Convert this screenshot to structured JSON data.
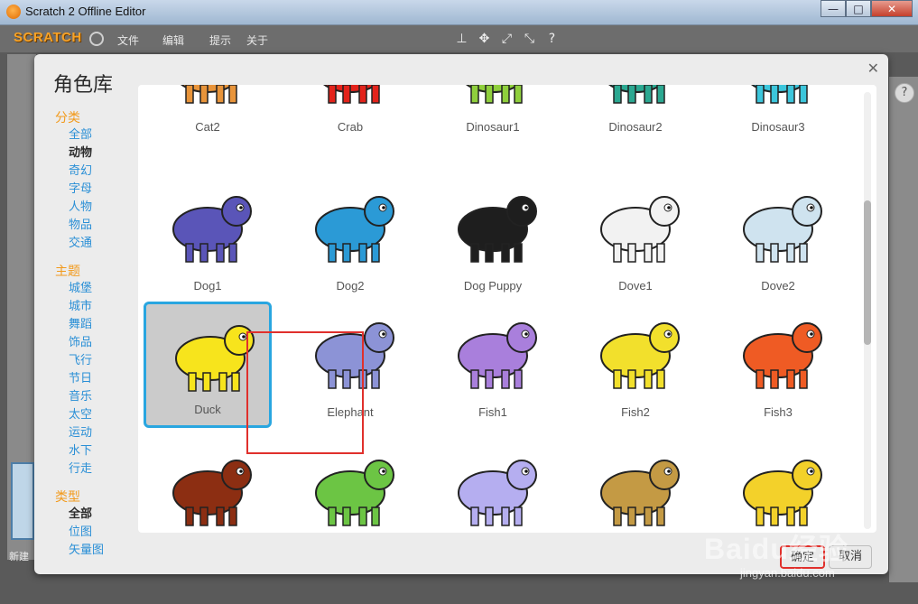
{
  "window": {
    "title": "Scratch 2 Offline Editor",
    "controls": [
      "—",
      "□",
      "✕"
    ]
  },
  "menubar": {
    "logo": "SCRATCH",
    "items": [
      "文件",
      "编辑",
      "提示",
      "关于"
    ]
  },
  "dialog": {
    "title": "角色库",
    "sidebar": {
      "category_head": "分类",
      "categories": [
        "全部",
        "动物",
        "奇幻",
        "字母",
        "人物",
        "物品",
        "交通"
      ],
      "active_category": "动物",
      "theme_head": "主题",
      "themes": [
        "城堡",
        "城市",
        "舞蹈",
        "饰品",
        "飞行",
        "节日",
        "音乐",
        "太空",
        "运动",
        "水下",
        "行走"
      ],
      "type_head": "类型",
      "types": [
        "全部",
        "位图",
        "矢量图"
      ],
      "active_type": "全部"
    },
    "sprites": [
      {
        "name": "Cat2",
        "icon": "cat-icon",
        "color": "#e8943a"
      },
      {
        "name": "Crab",
        "icon": "crab-icon",
        "color": "#e3231b"
      },
      {
        "name": "Dinosaur1",
        "icon": "dinosaur-icon",
        "color": "#8fcf3c"
      },
      {
        "name": "Dinosaur2",
        "icon": "dinosaur-icon",
        "color": "#2ba891"
      },
      {
        "name": "Dinosaur3",
        "icon": "dinosaur-icon",
        "color": "#3cc6dc"
      },
      {
        "name": "Dog1",
        "icon": "dog-icon",
        "color": "#5a55b8"
      },
      {
        "name": "Dog2",
        "icon": "dog-icon",
        "color": "#2b9ad6"
      },
      {
        "name": "Dog Puppy",
        "icon": "puppy-icon",
        "color": "#1e1e1e"
      },
      {
        "name": "Dove1",
        "icon": "dove-icon",
        "color": "#f2f2f2"
      },
      {
        "name": "Dove2",
        "icon": "dove-icon",
        "color": "#cfe3ef"
      },
      {
        "name": "Duck",
        "icon": "duck-icon",
        "color": "#f7e41c"
      },
      {
        "name": "Elephant",
        "icon": "elephant-icon",
        "color": "#8c93d6"
      },
      {
        "name": "Fish1",
        "icon": "fish-icon",
        "color": "#a97fdc"
      },
      {
        "name": "Fish2",
        "icon": "fish-icon",
        "color": "#f2e02c"
      },
      {
        "name": "Fish3",
        "icon": "fish-icon",
        "color": "#ef5b24"
      },
      {
        "name": "",
        "icon": "fox-icon",
        "color": "#8c2e12"
      },
      {
        "name": "",
        "icon": "frog-icon",
        "color": "#6cc544"
      },
      {
        "name": "",
        "icon": "hippo-icon",
        "color": "#b5aef0"
      },
      {
        "name": "",
        "icon": "horse-icon",
        "color": "#c49a44"
      },
      {
        "name": "",
        "icon": "ladybug-icon",
        "color": "#f3d12a"
      }
    ],
    "selected_sprite": "Duck",
    "ok_label": "确定",
    "cancel_label": "取消"
  },
  "background": {
    "new_sprite_label": "新建"
  },
  "watermark": {
    "text": "Baidu经验",
    "url": "jingyan.baidu.com"
  }
}
